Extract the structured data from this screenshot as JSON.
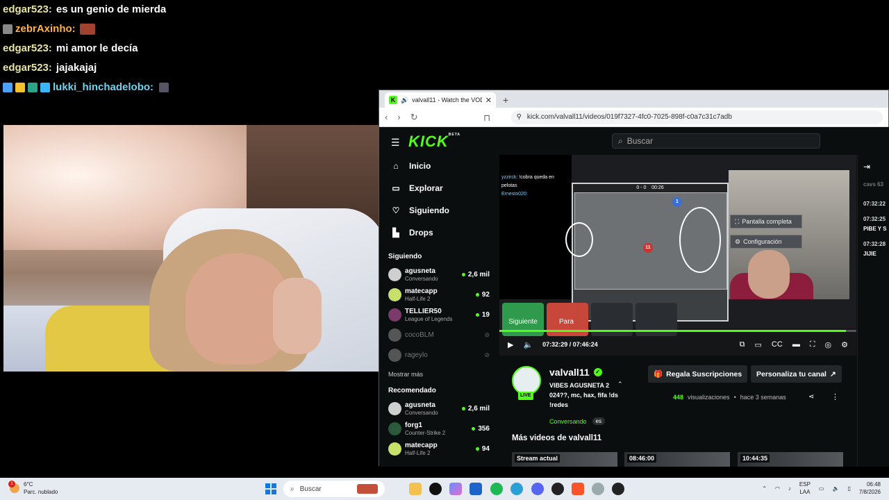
{
  "chat_overlay": [
    {
      "user": "edgar523:",
      "message": "es un genio de mierda",
      "color": "#e9e3a2"
    },
    {
      "user": "zebrAxinho:",
      "message": "",
      "color": "#ffb347"
    },
    {
      "user": "edgar523:",
      "message": "mi amor le decía",
      "color": "#e9e3a2"
    },
    {
      "user": "edgar523:",
      "message": "jajakajaj",
      "color": "#e9e3a2"
    },
    {
      "user": "lukki_hinchadelobo:",
      "message": "",
      "color": "#6fd3ef"
    }
  ],
  "browser": {
    "tab_title": "valvall11 - Watch the VOD o",
    "url": "kick.com/valvall11/videos/019f7327-4fc0-7025-898f-c0a7c31c7adb"
  },
  "kick": {
    "accent": "#53fc18",
    "logo": "KICK",
    "logo_badge": "BETA",
    "search_placeholder": "Buscar",
    "nav": [
      {
        "label": "Inicio",
        "icon": "home-icon"
      },
      {
        "label": "Explorar",
        "icon": "browse-icon"
      },
      {
        "label": "Siguiendo",
        "icon": "heart-icon"
      },
      {
        "label": "Drops",
        "icon": "drops-icon"
      }
    ],
    "following_title": "Siguiendo",
    "following": [
      {
        "name": "agusneta",
        "category": "Conversando",
        "viewers": "2,6 mil",
        "online": true
      },
      {
        "name": "matecapp",
        "category": "Half-Life 2",
        "viewers": "92",
        "online": true
      },
      {
        "name": "TELLIER50",
        "category": "League of Legends",
        "viewers": "19",
        "online": true
      },
      {
        "name": "cocoBLM",
        "category": "",
        "viewers": "",
        "online": false
      },
      {
        "name": "rageylo",
        "category": "",
        "viewers": "",
        "online": false
      }
    ],
    "show_more": "Mostrar más",
    "recommended_title": "Recomendado",
    "recommended": [
      {
        "name": "agusneta",
        "category": "Conversando",
        "viewers": "2,6 mil"
      },
      {
        "name": "forg1",
        "category": "Counter-Strike 2",
        "viewers": "356"
      },
      {
        "name": "matecapp",
        "category": "Half-Life 2",
        "viewers": "94"
      }
    ],
    "video": {
      "current_time": "07:32:29",
      "duration": "07:46:24",
      "progress": 0.97,
      "inner_chat": [
        {
          "user": "yzzirck:",
          "message": "!cobra queda en pelotas"
        },
        {
          "user": "Ernesto020:",
          "message": ""
        }
      ],
      "inner_menu": [
        "Pantalla completa",
        "Configuración"
      ],
      "score": "0 - 0",
      "game_time": "00:26",
      "player_numbers": [
        "1",
        "11"
      ],
      "overlay_buttons": [
        "Siguiente",
        "Para"
      ]
    },
    "chat_column": {
      "header": "cavs 63",
      "messages": [
        {
          "time": "07:32:22",
          "text": ""
        },
        {
          "time": "07:32:25",
          "text": "PIBE Y S"
        },
        {
          "time": "07:32:28",
          "text": "JIJIE"
        }
      ]
    },
    "channel": {
      "name": "valvall11",
      "live_badge": "LIVE",
      "stream_title": "VIBES AGUSNETA 2 024??, mc, hax, fifa !ds !redes",
      "category": "Conversando",
      "language": "es",
      "gift_button": "Regala Suscripciones",
      "customize_button": "Personaliza tu canal",
      "views_count": "448",
      "views_label": "visualizaciones",
      "time_ago": "hace 3 semanas"
    },
    "more_videos_title": "Más videos de valvall11",
    "thumbnails": [
      "Stream actual",
      "08:46:00",
      "10:44:35"
    ]
  },
  "taskbar": {
    "weather_temp": "6°C",
    "weather_desc": "Parc. nublado",
    "weather_badge": "1",
    "search_placeholder": "Buscar",
    "lang_top": "ESP",
    "lang_bottom": "LAA",
    "time": "06:48",
    "date": "7/8/2026"
  }
}
